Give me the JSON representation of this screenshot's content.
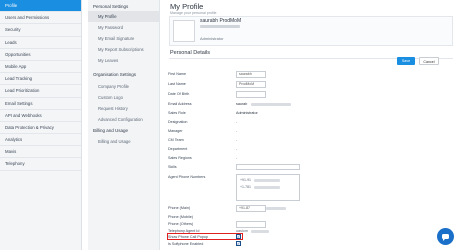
{
  "nav": {
    "items": [
      {
        "label": "Profile",
        "active": true
      },
      {
        "label": "Users and Permissions"
      },
      {
        "label": "Security"
      },
      {
        "label": "Leads"
      },
      {
        "label": "Opportunities"
      },
      {
        "label": "Mobile App"
      },
      {
        "label": "Lead Tracking"
      },
      {
        "label": "Lead Prioritization"
      },
      {
        "label": "Email Settings"
      },
      {
        "label": "API and Webhooks"
      },
      {
        "label": "Data Protection & Privacy"
      },
      {
        "label": "Analytics"
      },
      {
        "label": "Mavis"
      },
      {
        "label": "Telephony"
      }
    ]
  },
  "subnav": {
    "personal_settings": "Personal Settings",
    "personal_items": [
      {
        "label": "My Profile",
        "active": true
      },
      {
        "label": "My Password"
      },
      {
        "label": "My Email Signature"
      },
      {
        "label": "My Report Subscriptions"
      },
      {
        "label": "My Leaves"
      }
    ],
    "org_settings": "Organisation Settings",
    "org_items": [
      {
        "label": "Company Profile"
      },
      {
        "label": "Custom Logo"
      },
      {
        "label": "Request History"
      },
      {
        "label": "Advanced Configuration"
      }
    ],
    "billing": "Billing and Usage",
    "billing_items": [
      {
        "label": "Billing and Usage"
      }
    ]
  },
  "header": {
    "title": "My Profile",
    "subtitle": "Manage your personal profile"
  },
  "profile": {
    "name": "saurabh ProdMoM",
    "role": "Administrator"
  },
  "section": {
    "title": "Personal Details",
    "save": "Save",
    "cancel": "Cancel"
  },
  "fields": {
    "first_name": {
      "label": "First Name",
      "value": "saurabh"
    },
    "last_name": {
      "label": "Last Name",
      "value": "ProdMoM"
    },
    "dob": {
      "label": "Date Of Birth"
    },
    "email": {
      "label": "Email Address",
      "value": "saurab"
    },
    "sales_role": {
      "label": "Sales Role",
      "value": "Administrator"
    },
    "designation": {
      "label": "Designation",
      "value": "-"
    },
    "manager": {
      "label": "Manager",
      "value": "-"
    },
    "cm_team": {
      "label": "CM Team",
      "value": "-"
    },
    "department": {
      "label": "Department",
      "value": "-"
    },
    "sales_regions": {
      "label": "Sales Regions",
      "value": "-"
    },
    "skills": {
      "label": "Skills"
    },
    "agent_phones": {
      "label": "Agent Phone Numbers",
      "values": [
        "+91-91",
        "+1-781"
      ]
    },
    "phone_main": {
      "label": "Phone (Main)",
      "value": "+91-87"
    },
    "phone_mobile": {
      "label": "Phone (Mobile)"
    },
    "phone_others": {
      "label": "Phone (Others)"
    },
    "telephony_agent_id": {
      "label": "Telephony Agent Id",
      "value": "uaslom"
    },
    "show_phone_call_popup": {
      "label": "Show Phone Call Popup"
    },
    "softphone_enabled": {
      "label": "Is Softphone Enabled"
    }
  },
  "colors": {
    "accent": "#1a8ee1",
    "highlight": "#e01f1f",
    "chat": "#1a70c8"
  },
  "icons": {
    "chat": "chat-icon",
    "avatar": "avatar-placeholder",
    "check": "check-icon"
  }
}
